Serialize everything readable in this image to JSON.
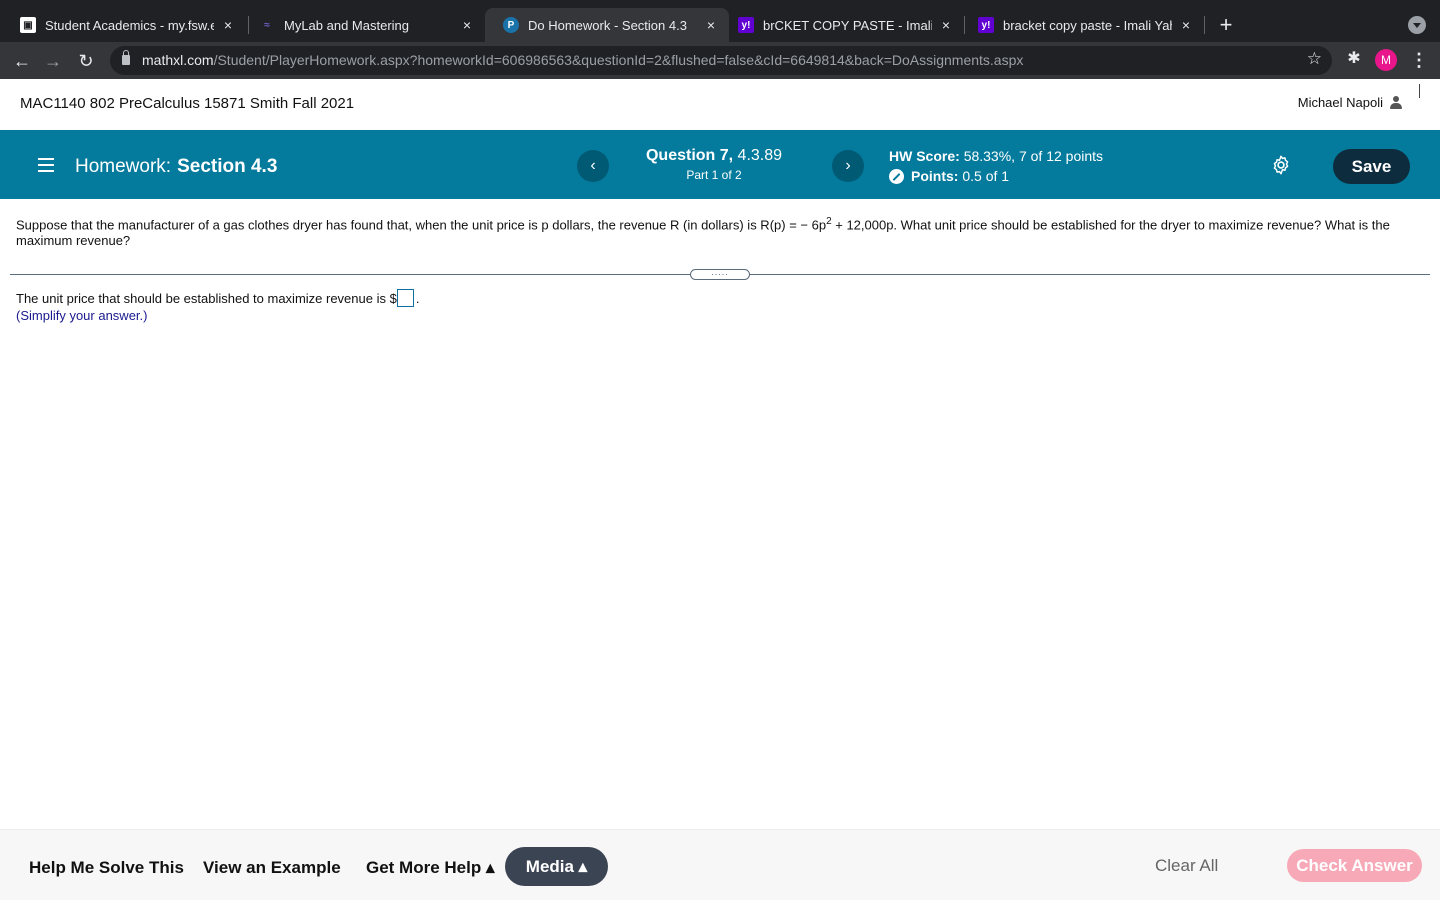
{
  "browser": {
    "tabs": [
      {
        "title": "Student Academics - my.fsw.e",
        "favicon": "fsw-icon",
        "active": false
      },
      {
        "title": "MyLab and Mastering",
        "favicon": "mylab-icon",
        "active": false
      },
      {
        "title": "Do Homework - Section 4.3",
        "favicon": "pearson-icon",
        "active": true
      },
      {
        "title": "brCKET COPY PASTE - Imali Ya",
        "favicon": "yahoo-icon",
        "active": false
      },
      {
        "title": "bracket copy paste - Imali Yah",
        "favicon": "yahoo-icon",
        "active": false
      }
    ],
    "close_glyph": "×",
    "new_tab_glyph": "+",
    "url_host": "mathxl.com",
    "url_path": "/Student/PlayerHomework.aspx?homeworkId=606986563&questionId=2&flushed=false&cId=6649814&back=DoAssignments.aspx",
    "profile_initial": "M"
  },
  "course": {
    "title": "MAC1140 802 PreCalculus 15871 Smith Fall 2021",
    "user_name": "Michael Napoli"
  },
  "homework": {
    "label": "Homework:",
    "section": "Section 4.3",
    "question_label": "Question 7,",
    "question_id": "4.3.89",
    "part": "Part 1 of 2",
    "hw_score_label": "HW Score:",
    "hw_score_value": "58.33%, 7 of 12 points",
    "points_label": "Points:",
    "points_value": "0.5 of 1",
    "save_label": "Save"
  },
  "question": {
    "text_before_sup": "Suppose that the manufacturer of a gas clothes dryer has found that, when the unit price is p dollars, the revenue R (in dollars) is R(p) = − 6p",
    "sup": "2",
    "text_after_sup": " + 12,000p. What unit price should be established for the dryer to maximize revenue? What is the maximum revenue?",
    "divider_handle": ".....",
    "answer_prefix": "The unit price that should be established to maximize revenue is $",
    "answer_suffix": ".",
    "hint": "(Simplify your answer.)"
  },
  "footer": {
    "help_me_solve": "Help Me Solve This",
    "view_example": "View an Example",
    "get_more_help": "Get More Help ▴",
    "media": "Media ▴",
    "clear_all": "Clear All",
    "check_answer": "Check Answer"
  },
  "colors": {
    "banner": "#047a9c",
    "save_button": "#0d2c3e",
    "media_button": "#3b4453",
    "check_answer": "#f7a9b8"
  }
}
